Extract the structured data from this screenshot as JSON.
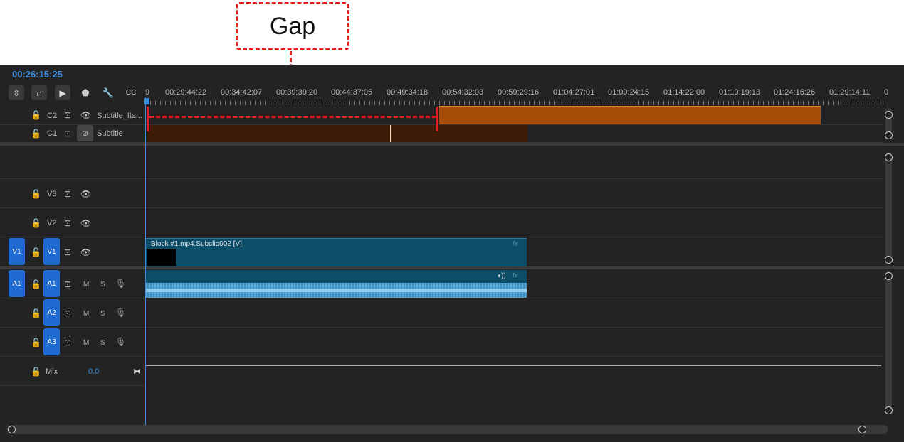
{
  "annotation": {
    "label": "Gap"
  },
  "timecode": "00:26:15:25",
  "toolbar": {
    "icons": [
      "insert-edit-icon",
      "snap-magnet-icon",
      "linked-selection-icon",
      "marker-icon",
      "wrench-icon",
      "captions-icon"
    ]
  },
  "ruler": {
    "start_fragment": "9",
    "labels": [
      "00:29:44:22",
      "00:34:42:07",
      "00:39:39:20",
      "00:44:37:05",
      "00:49:34:18",
      "00:54:32:03",
      "00:59:29:16",
      "01:04:27:01",
      "01:09:24:15",
      "01:14:22:00",
      "01:19:19:13",
      "01:24:16:26",
      "01:29:14:11"
    ],
    "end_fragment": "0"
  },
  "tracks": {
    "c2": {
      "id": "C2",
      "name": "Subtitle_Ita..."
    },
    "c1": {
      "id": "C1",
      "name": "Subtitle"
    },
    "v3": {
      "id": "V3"
    },
    "v2": {
      "id": "V2"
    },
    "v1": {
      "id": "V1",
      "source": "V1"
    },
    "a1": {
      "id": "A1",
      "source": "A1",
      "m": "M",
      "s": "S"
    },
    "a2": {
      "id": "A2",
      "m": "M",
      "s": "S"
    },
    "a3": {
      "id": "A3",
      "m": "M",
      "s": "S"
    },
    "mix": {
      "label": "Mix",
      "value": "0.0"
    }
  },
  "clips": {
    "v1_clip": {
      "label": "Block #1.mp4.Subclip002 [V]",
      "fx": "fx"
    },
    "a1_clip": {
      "fx": "fx"
    }
  },
  "colors": {
    "accent": "#3e8ede",
    "annotation": "#dd2222",
    "caption_active": "#a74c09",
    "caption_dim": "#3d1c07",
    "video_clip": "#0b4e69",
    "track_button": "#1f6bd1"
  }
}
